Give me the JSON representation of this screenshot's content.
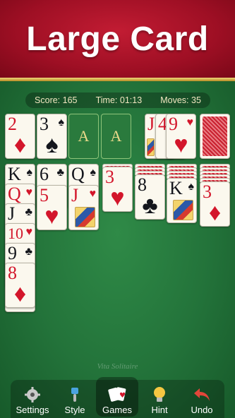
{
  "banner": {
    "title": "Large Card"
  },
  "stats": {
    "score_label": "Score:",
    "score": "165",
    "time_label": "Time:",
    "time": "01:13",
    "moves_label": "Moves:",
    "moves": "35"
  },
  "top_row": {
    "waste_left": [
      {
        "rank": "2",
        "suit": "♦",
        "color": "red"
      },
      {
        "rank": "3",
        "suit": "♠",
        "color": "black"
      }
    ],
    "foundations": [
      {
        "rank": "A"
      },
      {
        "rank": "A"
      }
    ],
    "waste_right": [
      {
        "rank": "J",
        "color": "red"
      },
      {
        "rank": "4",
        "color": "red"
      },
      {
        "rank": "9",
        "suit": "♥",
        "color": "red"
      }
    ]
  },
  "tableau": {
    "col1": [
      {
        "rank": "K",
        "suit": "♠",
        "color": "black"
      },
      {
        "rank": "Q",
        "suit": "♥",
        "color": "red"
      },
      {
        "rank": "J",
        "suit": "♣",
        "color": "black"
      },
      {
        "rank": "10",
        "suit": "♥",
        "color": "red"
      },
      {
        "rank": "9",
        "suit": "♣",
        "color": "black"
      },
      {
        "rank": "8",
        "suit": "♦",
        "color": "red"
      }
    ],
    "col2": [
      {
        "rank": "6",
        "suit": "♣",
        "color": "black"
      },
      {
        "rank": "5",
        "suit": "♥",
        "color": "red"
      }
    ],
    "col3": [
      {
        "rank": "Q",
        "suit": "♠",
        "color": "black"
      },
      {
        "rank": "J",
        "suit": "♥",
        "color": "red"
      }
    ],
    "col4": [
      {
        "rank": "3",
        "suit": "♥",
        "color": "red"
      }
    ],
    "col5": [
      {
        "rank": "8",
        "suit": "♣",
        "color": "black"
      }
    ],
    "col6": [
      {
        "rank": "K",
        "suit": "♠",
        "color": "black"
      }
    ],
    "col7": [
      {
        "rank": "3",
        "suit": "♦",
        "color": "red"
      }
    ]
  },
  "watermark": "Vita Solitaire",
  "toolbar": {
    "settings": "Settings",
    "style": "Style",
    "games": "Games",
    "hint": "Hint",
    "undo": "Undo"
  },
  "colors": {
    "felt": "#23733a",
    "banner": "#9e0f24",
    "card_red": "#d3162b",
    "card_black": "#14161c"
  }
}
